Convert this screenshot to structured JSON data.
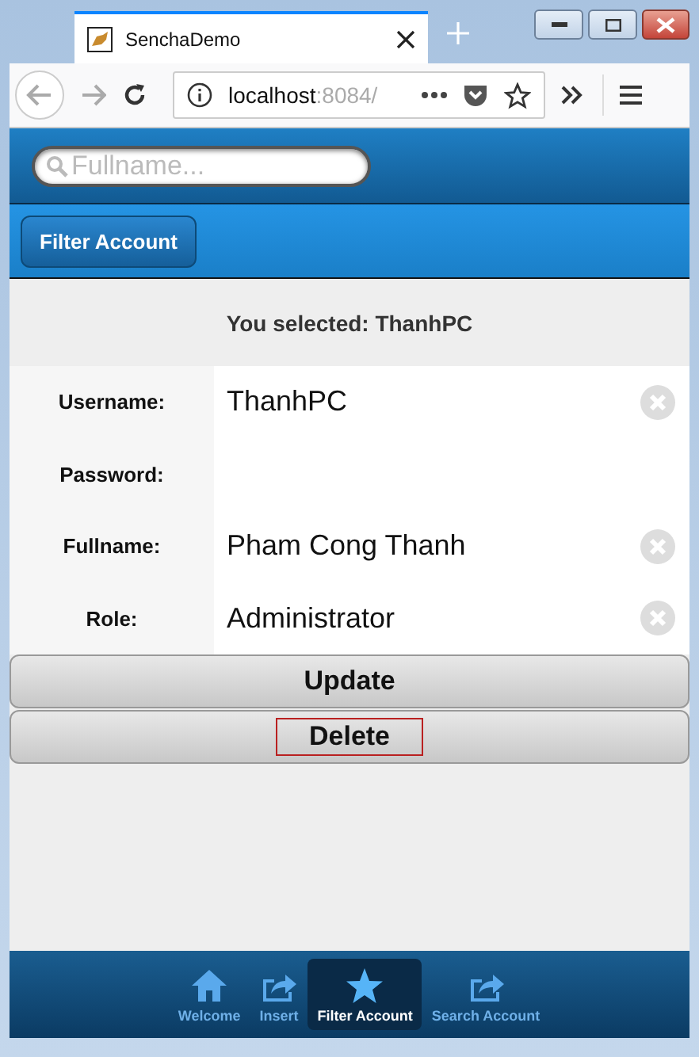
{
  "browser": {
    "tab_title": "SenchaDemo",
    "address_host": "localhost",
    "address_rest": ":8084/"
  },
  "search": {
    "placeholder": "Fullname..."
  },
  "toolbar": {
    "button": "Filter Account"
  },
  "selection_text": "You selected: ThanhPC",
  "fields": [
    {
      "label": "Username:",
      "value": "ThanhPC",
      "clearable": true
    },
    {
      "label": "Password:",
      "clearable": false
    },
    {
      "label": "Fullname:",
      "value": "Pham Cong Thanh",
      "clearable": true
    },
    {
      "label": "Role:",
      "value": "Administrator",
      "clearable": true
    }
  ],
  "buttons": [
    {
      "label": "Update",
      "focused": false
    },
    {
      "label": "Delete",
      "focused": true
    }
  ],
  "tabbar": [
    {
      "label": "Welcome",
      "kind": "home",
      "selected": false
    },
    {
      "label": "Insert",
      "kind": "share",
      "selected": false
    },
    {
      "label": "Filter Account",
      "kind": "star",
      "selected": true
    },
    {
      "label": "Search Account",
      "kind": "share",
      "selected": false
    }
  ]
}
